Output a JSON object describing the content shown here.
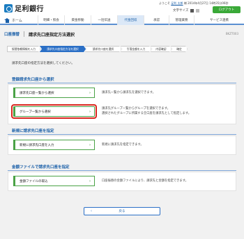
{
  "header": {
    "bank_name": "足利銀行",
    "user_prefix": "ようこそ",
    "user_name": "足利 太郎",
    "user_suffix": "様 2014年4月27日 14時35分06秒",
    "font_size_label": "文字サイズ",
    "logout_label": "ログアウト"
  },
  "nav": {
    "items": [
      {
        "label": "ホーム"
      },
      {
        "label": "明細・照会"
      },
      {
        "label": "資金移動"
      },
      {
        "label": "一括伝送"
      },
      {
        "label": "代金回収"
      },
      {
        "label": "承認"
      },
      {
        "label": "管理業務"
      },
      {
        "label": "サービス連携"
      }
    ],
    "active_index": 4
  },
  "page": {
    "category": "口座振替",
    "title": "請求先口座指定方法選択",
    "code": "BKZT003"
  },
  "steps": [
    {
      "label": "振替依頼情報を入力"
    },
    {
      "label": "請求先口座指定方法を選択"
    },
    {
      "label": "請求先口座を選択"
    },
    {
      "label": "引落金額を入力"
    },
    {
      "label": "内容確認"
    },
    {
      "label": "確定"
    }
  ],
  "instruction": "請求先口座の指定方法を選択してください。",
  "sections": [
    {
      "heading": "登録請求先口座から選択",
      "options": [
        {
          "label": "請求先口座一覧から選択",
          "desc": [
            "請求先一覧から請求先を選択できます。"
          ]
        },
        {
          "label": "グループ一覧から選択",
          "desc": [
            "請求先グループ一覧からグループを選択できます。",
            "選択されたグループに所属する全口座を請求先として指定します。"
          ]
        }
      ]
    },
    {
      "heading": "新規に請求先口座を指定",
      "options": [
        {
          "label": "新規に請求先口座を入力",
          "desc": [
            "新規に請求先を指定できます。"
          ]
        }
      ]
    },
    {
      "heading": "金額ファイルで請求先口座を指定",
      "options": [
        {
          "label": "金額ファイルの取込",
          "desc": [
            "口座振替の金額ファイルにより、請求先と金額を指定できます。"
          ]
        }
      ]
    }
  ],
  "back_label": "戻る",
  "colors": {
    "brand_blue": "#1a5fa8",
    "active_step": "#2a6fc6",
    "action_green": "#3aa938",
    "highlight_red": "#d9251d"
  }
}
